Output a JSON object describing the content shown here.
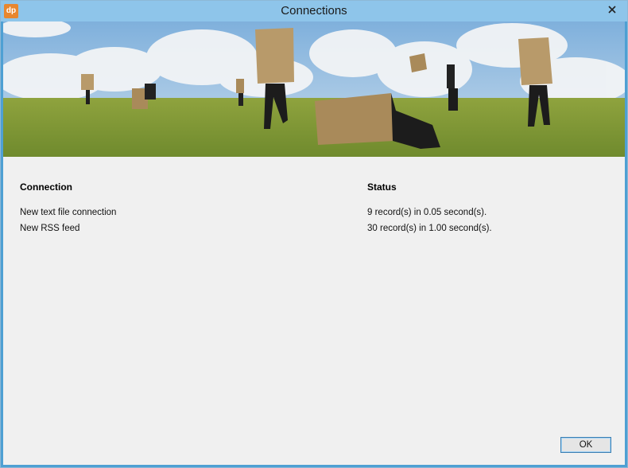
{
  "window": {
    "title": "Connections",
    "app_icon_text": "dp"
  },
  "table": {
    "headers": {
      "connection": "Connection",
      "status": "Status"
    },
    "rows": [
      {
        "connection": "New text file connection",
        "status": "9 record(s) in 0.05 second(s)."
      },
      {
        "connection": "New RSS feed",
        "status": "30 record(s) in 1.00 second(s)."
      }
    ]
  },
  "buttons": {
    "ok": "OK"
  },
  "colors": {
    "titlebar": "#8ec5ea",
    "client": "#f0f0f0",
    "close_red": "#c0392b"
  }
}
